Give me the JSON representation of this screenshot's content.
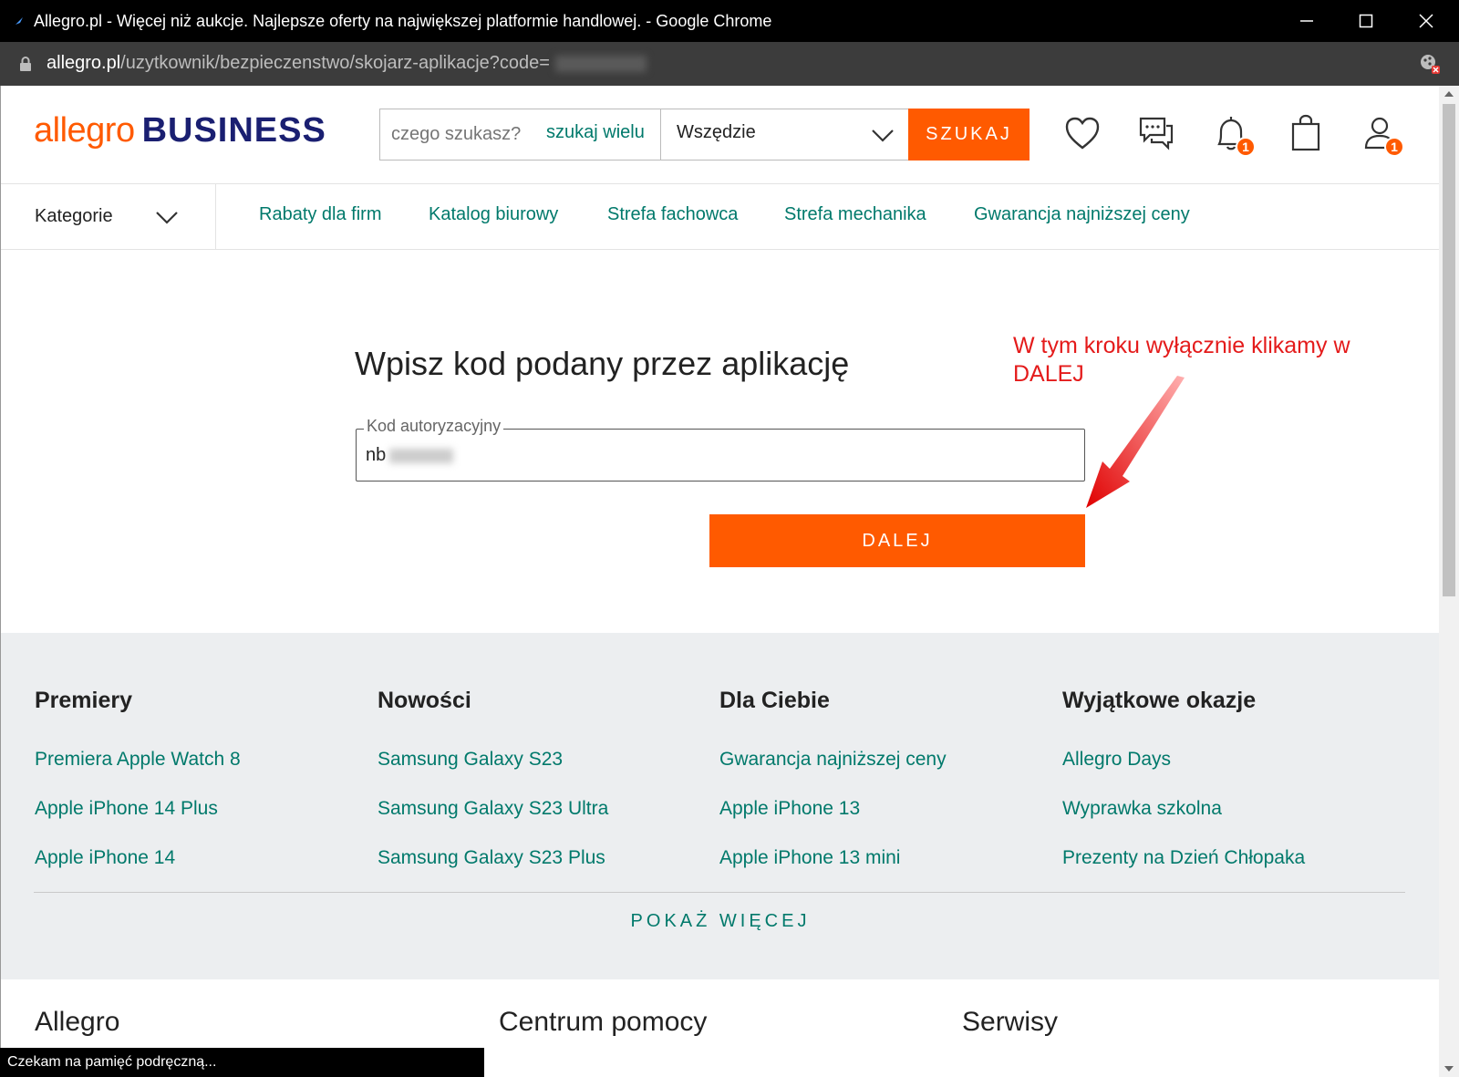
{
  "window": {
    "title": "Allegro.pl - Więcej niż aukcje. Najlepsze oferty na największej platformie handlowej. - Google Chrome",
    "url_host": "allegro.pl",
    "url_path": "/uzytkownik/bezpieczenstwo/skojarz-aplikacje?code="
  },
  "header": {
    "logo_a": "allegro",
    "logo_b": "BUSINESS",
    "search_placeholder": "czego szukasz?",
    "search_multi": "szukaj wielu",
    "search_scope": "Wszędzie",
    "search_button": "SZUKAJ",
    "notifications_badge": "1",
    "account_badge": "1"
  },
  "nav": {
    "categories": "Kategorie",
    "links": [
      "Rabaty dla firm",
      "Katalog biurowy",
      "Strefa fachowca",
      "Strefa mechanika",
      "Gwarancja najniższej ceny"
    ]
  },
  "form": {
    "heading": "Wpisz kod podany przez aplikację",
    "field_label": "Kod autoryzacyjny",
    "field_value": "nb",
    "submit": "DALEJ"
  },
  "annotation": "W tym kroku wyłącznie klikamy w DALEJ",
  "footer": {
    "columns": [
      {
        "title": "Premiery",
        "links": [
          "Premiera Apple Watch 8",
          "Apple iPhone 14 Plus",
          "Apple iPhone 14"
        ]
      },
      {
        "title": "Nowości",
        "links": [
          "Samsung Galaxy S23",
          "Samsung Galaxy S23 Ultra",
          "Samsung Galaxy S23 Plus"
        ]
      },
      {
        "title": "Dla Ciebie",
        "links": [
          "Gwarancja najniższej ceny",
          "Apple iPhone 13",
          "Apple iPhone 13 mini"
        ]
      },
      {
        "title": "Wyjątkowe okazje",
        "links": [
          "Allegro Days",
          "Wyprawka szkolna",
          "Prezenty na Dzień Chłopaka"
        ]
      }
    ],
    "show_more": "POKAŻ WIĘCEJ",
    "sections": [
      "Allegro",
      "Centrum pomocy",
      "Serwisy"
    ]
  },
  "status_bar": "Czekam na pamięć podręczną...",
  "colors": {
    "brand_orange": "#ff5a00",
    "link_teal": "#00796b",
    "business_navy": "#1a1f71"
  }
}
